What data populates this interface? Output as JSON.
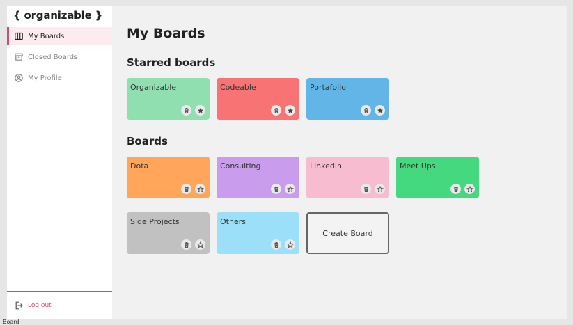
{
  "app": {
    "logo": "{ organizable }"
  },
  "sidebar": {
    "items": [
      {
        "label": "My Boards",
        "icon": "columns-icon"
      },
      {
        "label": "Closed Boards",
        "icon": "archive-icon"
      },
      {
        "label": "My Profile",
        "icon": "user-circle-icon"
      }
    ],
    "logout": {
      "label": "Log out",
      "icon": "logout-icon"
    }
  },
  "main": {
    "title": "My Boards",
    "starred_title": "Starred boards",
    "boards_title": "Boards",
    "starred": [
      {
        "name": "Organizable",
        "color": "#8fdfb0"
      },
      {
        "name": "Codeable",
        "color": "#f87474"
      },
      {
        "name": "Portafolio",
        "color": "#62b6e7"
      }
    ],
    "boards": [
      {
        "name": "Dota",
        "color": "#ffa65b"
      },
      {
        "name": "Consulting",
        "color": "#c99ced"
      },
      {
        "name": "Linkedin",
        "color": "#f8bcd0"
      },
      {
        "name": "Meet Ups",
        "color": "#44d97f"
      },
      {
        "name": "Side Projects",
        "color": "#c1c1c1"
      },
      {
        "name": "Others",
        "color": "#9bdff8"
      }
    ],
    "create_label": "Create Board"
  },
  "colors": {
    "accent": "#d9476b",
    "sidebar_active_bg": "#fcebef"
  },
  "footer_text": "Board"
}
